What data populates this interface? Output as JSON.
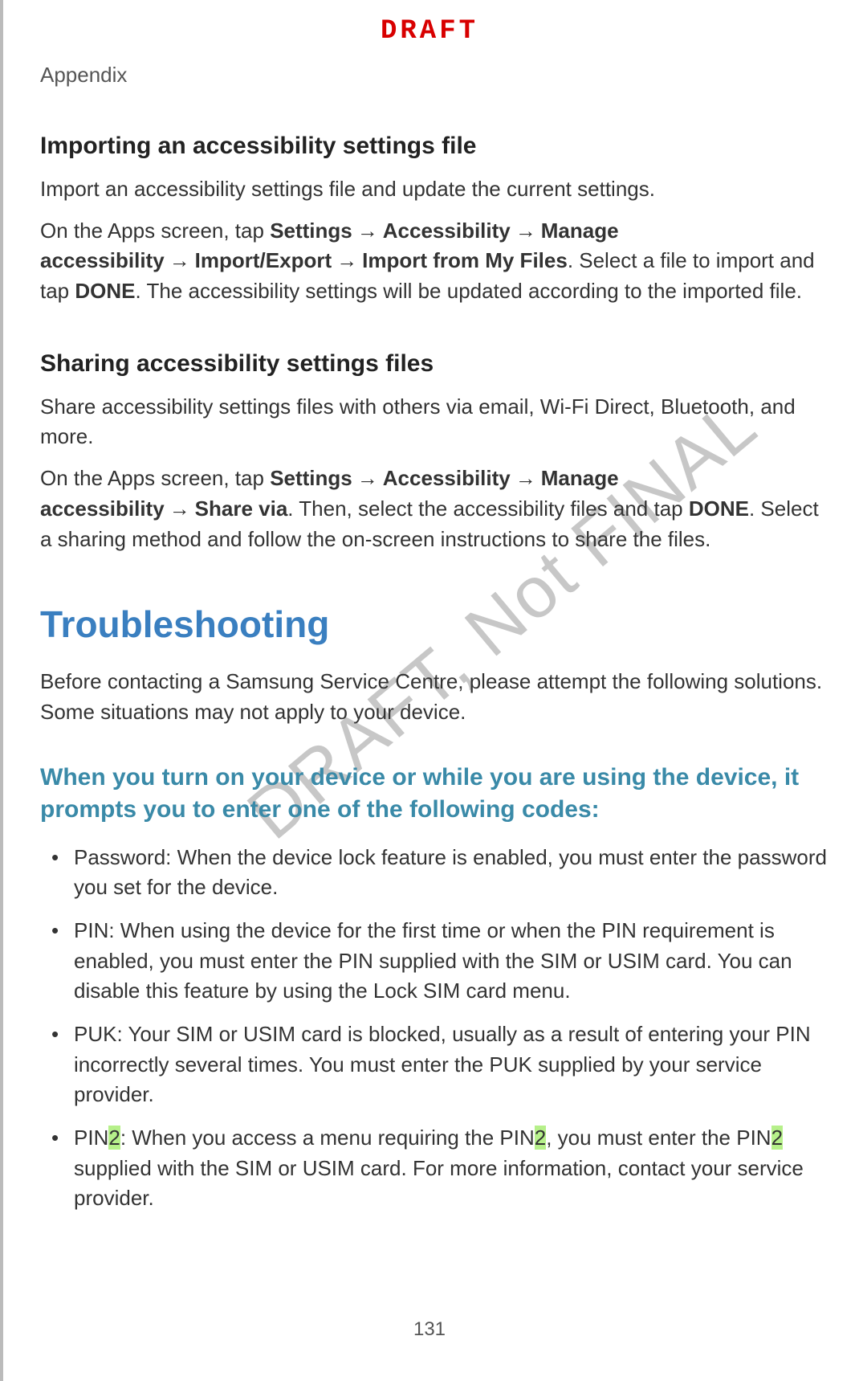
{
  "draft_label": "DRAFT",
  "header": "Appendix",
  "watermark": "DRAFT, Not FINAL",
  "page_number": "131",
  "sec1": {
    "heading": "Importing an accessibility settings file",
    "p1": "Import an accessibility settings file and update the current settings.",
    "p2_pre": "On the Apps screen, tap ",
    "b_settings": "Settings",
    "arrow": "→",
    "b_access": "Accessibility",
    "b_manage": "Manage accessibility",
    "b_importexport": "Import/Export",
    "b_importfiles": "Import from My Files",
    "p2_mid": ". Select a file to import and tap ",
    "b_done": "DONE",
    "p2_post": ". The accessibility settings will be updated according to the imported file."
  },
  "sec2": {
    "heading": "Sharing accessibility settings files",
    "p1": "Share accessibility settings files with others via email, Wi-Fi Direct, Bluetooth, and more.",
    "p2_pre": "On the Apps screen, tap ",
    "b_sharevia": "Share via",
    "p2_mid": ". Then, select the accessibility files and tap ",
    "p2_post": ". Select a sharing method and follow the on-screen instructions to share the files."
  },
  "troubleshooting": {
    "heading": "Troubleshooting",
    "intro": "Before contacting a Samsung Service Centre, please attempt the following solutions. Some situations may not apply to your device.",
    "sub1": "When you turn on your device or while you are using the device, it prompts you to enter one of the following codes:",
    "bullets": {
      "b1": "Password: When the device lock feature is enabled, you must enter the password you set for the device.",
      "b2": "PIN: When using the device for the first time or when the PIN requirement is enabled, you must enter the PIN supplied with the SIM or USIM card. You can disable this feature by using the Lock SIM card menu.",
      "b3": "PUK: Your SIM or USIM card is blocked, usually as a result of entering your PIN incorrectly several times. You must enter the PUK supplied by your service provider.",
      "b4_a": "PIN",
      "b4_hl1": "2",
      "b4_b": ": When you access a menu requiring the PIN",
      "b4_hl2": "2",
      "b4_c": ", you must enter the PIN",
      "b4_hl3": "2",
      "b4_d": " supplied with the SIM or USIM card. For more information, contact your service provider."
    }
  }
}
